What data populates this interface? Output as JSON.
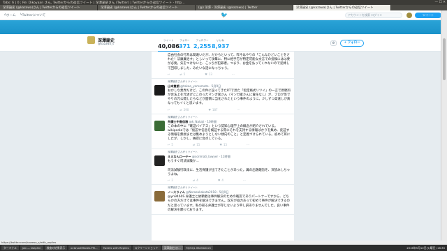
{
  "window": {
    "title": "Tabs: 6 | 0 ; Re: Dikoyaan さん, Twitterからの返信ツイート | 深澤諭史さん (Twitter) | Twitterからの返信ツイート - http...",
    "controls": "— ☐ ✕"
  },
  "tabs": [
    {
      "label": "深澤諭史 (@kazawa)さん | Twitterからの返信ツイート"
    },
    {
      "label": "深澤諭史 (@kazawa)さん | Twitterからの返信ツイート"
    },
    {
      "label": "(@) 深澤 - 深澤諭史 (@kazawa) | Twitter"
    },
    {
      "label": "深澤諭史 (@kazawa)さん | Twitterからの返信ツイート"
    }
  ],
  "twitter_nav": {
    "home": "ホーム",
    "notifications": "Twitterについて",
    "search_placeholder": "アカウントを検索 ログイン",
    "tweet_button": "ツイート"
  },
  "profile": {
    "name": "深澤諭史",
    "handle": "@kazawa_s",
    "stats": [
      {
        "label": "ツイート",
        "value": "40,086"
      },
      {
        "label": "フォロー",
        "value": "371"
      },
      {
        "label": "フォロワー",
        "value": "2,255"
      },
      {
        "label": "いいね",
        "value": "8,937"
      }
    ],
    "follow_label": "フォロー"
  },
  "tweets": [
    {
      "rt": "",
      "name": "",
      "handle": "",
      "text": "自由社会の行為は間違いだが、だからといって、昨今はやりの「こんなひどいことをされた！法廉廉治す」としいって攻撃に、特に相手方が特定可能な文言での投稿にはは要が必要。気をつけないと、こっちが犯罪者。つまり、お金を払ってくれないので泥棒して回収しました、みたいな話になっちゃう。",
      "acts": [
        "5",
        "13",
        ""
      ],
      "avatar_color": "#ffffff"
    },
    {
      "rt": "深澤諭史さんがリツイート",
      "name": "山本貴朗",
      "handle": "@takao_yamamoto · 5月9日",
      "text": "おかしな業界だけど、この件に設ってきたRTで見た「指定格式リツイ」の一言で原稿料が合法上を元述げにこのったマンガ家さん（マンガ家さんに責任なし）が、ブログ等でやりの元公開したらなどが面倒に当化されたという事件のように。少しずつ高速しが真なってもイくと思います。",
      "acts": [
        "",
        "290",
        "187"
      ],
      "avatar_color": "#1a1a1a"
    },
    {
      "rt": "深澤諭史さんがリツイート",
      "name": "弁護士中島佳雅",
      "handle": "@k_Nakaji · 10時間",
      "text": "この本の中に「確証バイアス」という認知心理学上の概念が紹介されている。wikipediaでは「仮説や信念を検証する際にそれを支持する情報ばかりを集め、反証する情報を無視または集めようとしない傾向のこと」と定義づけられている。初めて耳にしたが、しかし、納得に合点している。",
      "acts": [
        "5",
        "15",
        "15"
      ],
      "avatar_color": "#3a6b35"
    },
    {
      "rt": "深澤諭史さんがリツイート",
      "name": "ええなんロ一ヤー",
      "handle": "@sorimati_lawyer · 11時間",
      "text": "もうすぐ司法試験か…\n\n司法試験行政法に、生活保護が出てきたことがあった。翼の出題趣旨を、深読みしちゃうよね。",
      "acts": [
        "2",
        "4",
        "4"
      ],
      "avatar_color": "#222222"
    },
    {
      "rt": "深澤諭史さんがリツイート",
      "name": "ノースライム",
      "handle": "@Norasakakata2018 · 5月9日",
      "text": "@yn9460S 弁護士と依頼者は事件解決のための戦友でありパートナーですから、どちらかの方だけでは事件を解決できません。双方が協力あって初めて事件が解決できるのだと思っています。私の知る弁護士が存じないよう申し訳ありませんでした。良い事件の解決を願っております。",
      "acts": [
        "",
        "",
        ""
      ],
      "avatar_color": "#8a6b3a"
    }
  ],
  "status_url": "https://twitter.com/kazawa_s/with_replies",
  "taskbar": {
    "items": [
      "ターミナル",
      "job — Dolphin",
      "検査の結果表示",
      "octavo2RKoDb-PM...",
      "Tweets with Replies",
      "スクリーンショット",
      "深澤諭史(@...",
      "MySQL Workbench",
      "",
      ""
    ],
    "clock": "2016年5月10日(火曜日) 16:35"
  }
}
